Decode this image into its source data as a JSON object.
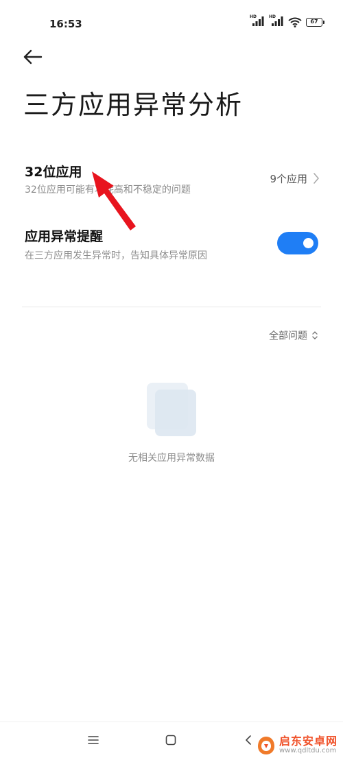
{
  "status_bar": {
    "time": "16:53",
    "signal_badge": "HD",
    "battery": "67",
    "icons": [
      "hd-signal-icon",
      "hd-signal-icon",
      "wifi-icon",
      "battery-icon"
    ]
  },
  "header": {
    "title": "三方应用异常分析",
    "back_icon": "arrow-left-icon"
  },
  "settings": {
    "app32": {
      "title": "32位应用",
      "subtitle": "32位应用可能有功耗高和不稳定的问题",
      "value": "9个应用"
    },
    "alert": {
      "title": "应用异常提醒",
      "subtitle": "在三方应用发生异常时，告知具体异常原因",
      "enabled": true
    }
  },
  "filter": {
    "label": "全部问题"
  },
  "empty_state": {
    "text": "无相关应用异常数据"
  },
  "nav": {
    "icons": [
      "menu-icon",
      "home-icon",
      "back-icon"
    ]
  },
  "watermark": {
    "name": "启东安卓网",
    "url": "www.qdltdu.com"
  },
  "colors": {
    "accent": "#1f7ef5",
    "arrow": "#e8141e",
    "watermark": "#f0522a"
  }
}
